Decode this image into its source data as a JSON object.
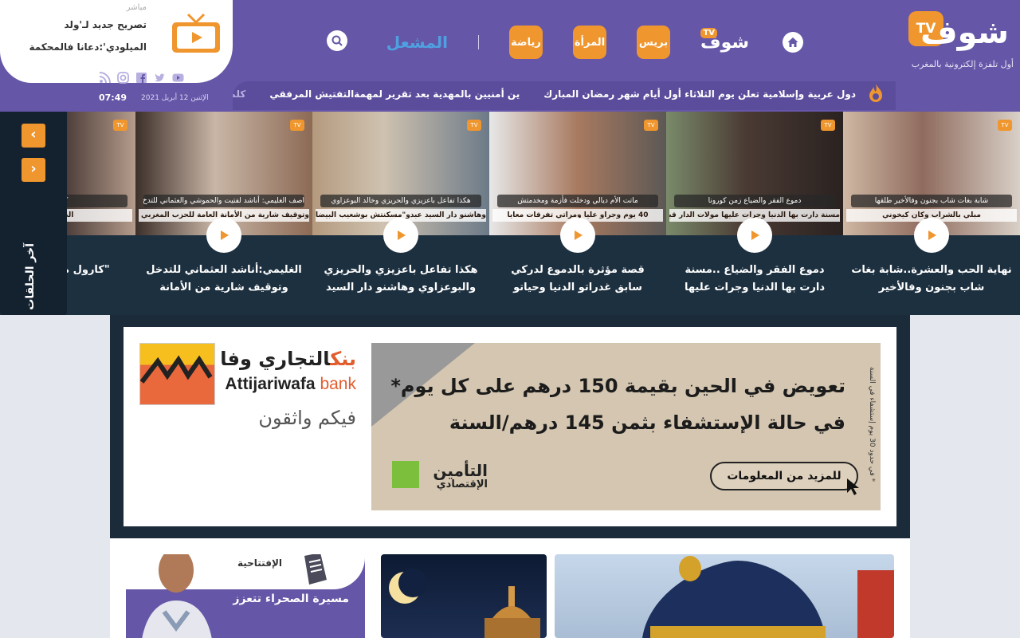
{
  "brand": {
    "logo_tv": "TV",
    "logo_word": "شوف",
    "tagline": "أول تلفزة إلكترونية بالمغرب"
  },
  "nav": {
    "shouf_tv": "شوف",
    "shouf_tv_badge": "TV",
    "press": "بريس",
    "women": "المرأة",
    "sport": "رياضة",
    "mashal": "المشعل"
  },
  "ticker": {
    "items": [
      "دول عربية وإسلامية تعلن يوم الثلاثاء أول أيام شهر رمضان المبارك",
      "ين أمنيين بالمهدية بعد تقرير لمهمةالتفتيش المرفقي",
      "كلمية"
    ]
  },
  "live": {
    "tag": "مباشر",
    "headline_1": "تصريح جديد لـ'ولد",
    "headline_2": "الميلودي':دعانا فالمحكمة"
  },
  "datetime": {
    "date": "الإثنين 12 أبريل 2021",
    "time": "07:49"
  },
  "episodes": {
    "side_label": "آخر الحلقات",
    "next": "›",
    "prev": "‹",
    "items": [
      {
        "title": "نهاية الحب والعشرة..شابة بغات شاب بجنون وفالأخير",
        "cap": "شابة بغات شاب بجنون وفالأخير طلقها",
        "cap2": "مبلي بالشراب وكان كيخوني"
      },
      {
        "title": "دموع الفقر والضياع ..مسنة دارت بها الدنيا وجرات عليها",
        "cap": "دموع الفقر والضياع زمن كورونا",
        "cap2": "مسنة دارت بها الدنيا وجرات عليها مولات الدار قبل رمضان"
      },
      {
        "title": "قصة مؤثرة بالدموع لدركي سابق غدراتو الدنيا وحياتو",
        "cap": "ماتت الأم ديالي ودخلت فأزمة ومخدمتش",
        "cap2": "40 يوم وجراو عليا ومراتي تفرقات معايا"
      },
      {
        "title": "هكذا تفاعل باعزيزي والحريزي والبوعزاوي وهاشنو دار السيد",
        "cap": "هكذا تفاعل باعزيزي والحريزي وخالد البوعزاوي",
        "cap2": "وهاشنو دار السيد عبدو\"مسكنتش بوشعيب البيضاوي"
      },
      {
        "title": "الغليمي:أناشد العثماني للتدخل وتوقيف شارية من الأمانة",
        "cap": "اصف الغليمي: أناشد لفتيت والحموشي والعثماني للتدخ",
        "cap2": "وتوقيف شارية من الأمانة العامة للحزب المغربي الحر"
      },
      {
        "title": "\"كارول موسي البارز بال",
        "cap": "كارول موسلي",
        "cap2": "الديمقراطي الأ"
      }
    ]
  },
  "ad": {
    "bank_ar": "التجاري وفا",
    "bank_ar_suffix": "بنك",
    "bank_en": "Attijariwafa",
    "bank_en_suffix": "bank",
    "slogan": "فيكم واثقون",
    "line1": "تعويض في الحين بقيمة 150 درهم على كل يوم*",
    "line2": "في حالة الإستشفاء بثمن 145 درهم/السنة",
    "side_note": "* في حدود 30 يوم إستشفاء في السنة",
    "cta": "للمزيد من المعلومات",
    "insurer": "التأمين",
    "insurer_sub": "الإقتصادي"
  },
  "editorial": {
    "kicker": "الإفتتاحية",
    "headline": "مسيرة الصحراء تتعزز"
  },
  "colors": {
    "header": "#6556a7",
    "accent": "#f0962e",
    "strip": "#1d3040"
  }
}
